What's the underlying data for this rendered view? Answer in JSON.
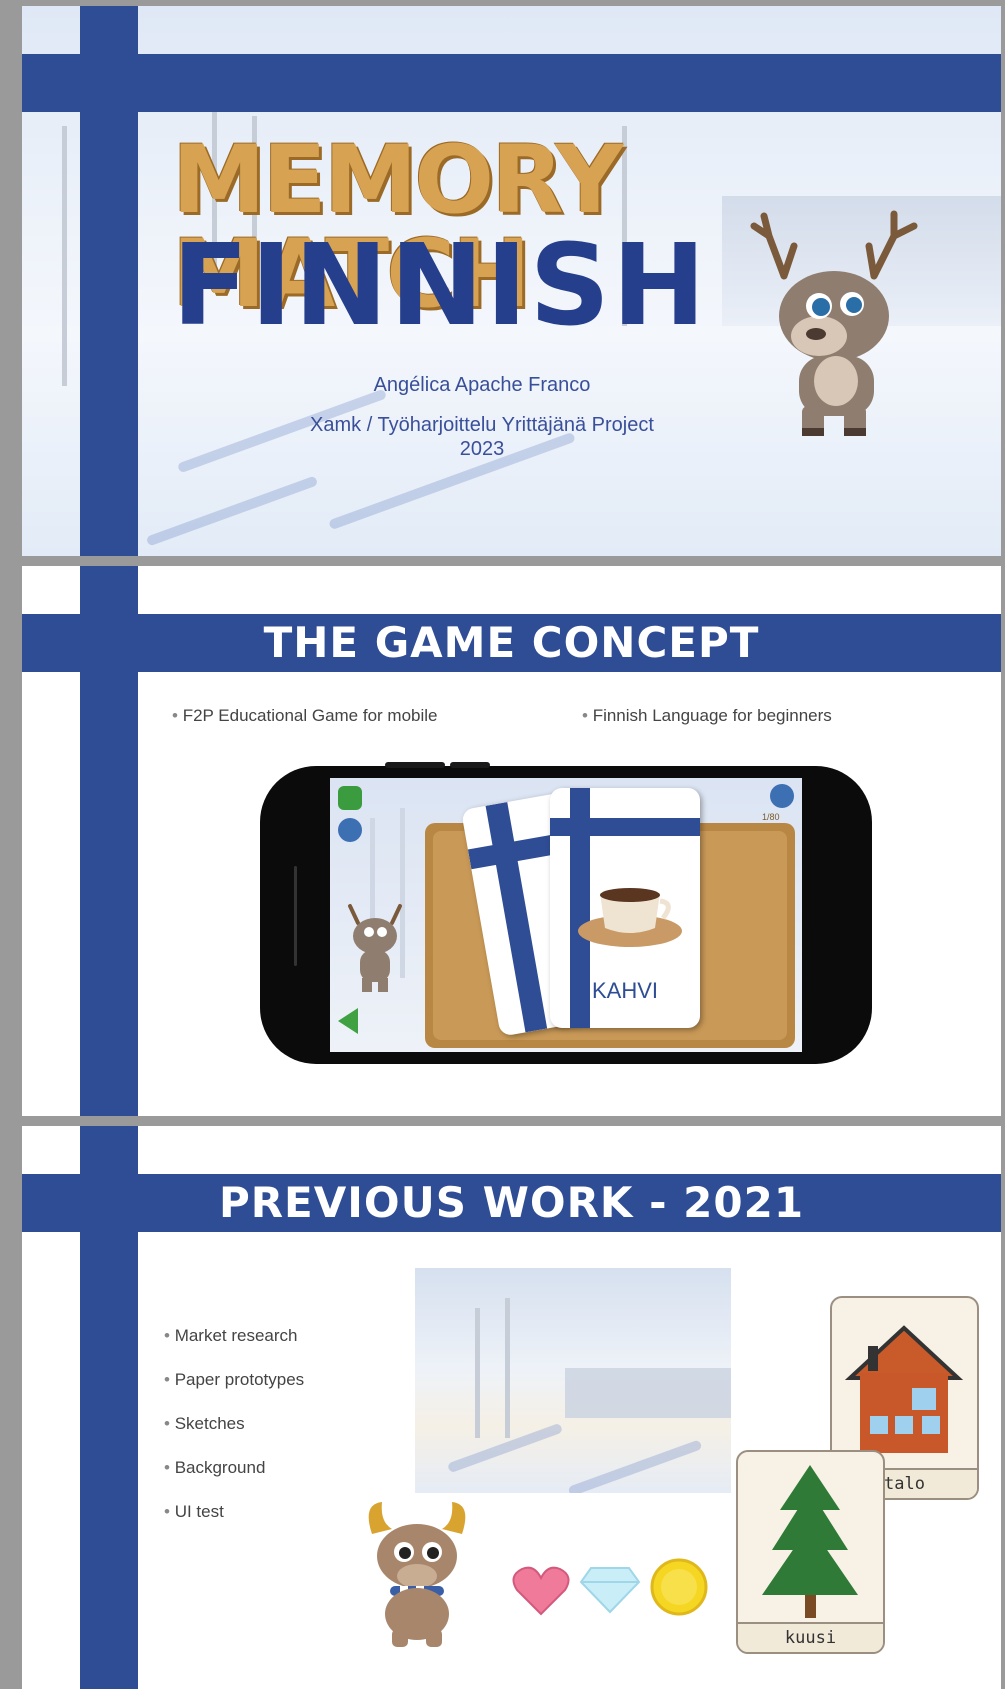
{
  "slide1": {
    "title_line1": "MEMORY MATCH",
    "title_line2": "FINNISH",
    "author": "Angélica Apache Franco",
    "institution": "Xamk / Työharjoittelu Yrittäjänä Project",
    "year": "2023"
  },
  "slide2": {
    "heading": "THE GAME CONCEPT",
    "bullets": [
      "F2P Educational Game for mobile",
      "Finnish Language for beginners"
    ],
    "card_word": "KAHVI",
    "counter": "1/80"
  },
  "slide3": {
    "heading": "PREVIOUS WORK - 2021",
    "bullets": [
      "Market research",
      "Paper prototypes",
      "Sketches",
      "Background",
      "UI test"
    ],
    "card_house": "talo",
    "card_tree": "kuusi"
  },
  "colors": {
    "flag_blue": "#2f4d94",
    "gold": "#d7a353",
    "navy": "#263f8c"
  }
}
